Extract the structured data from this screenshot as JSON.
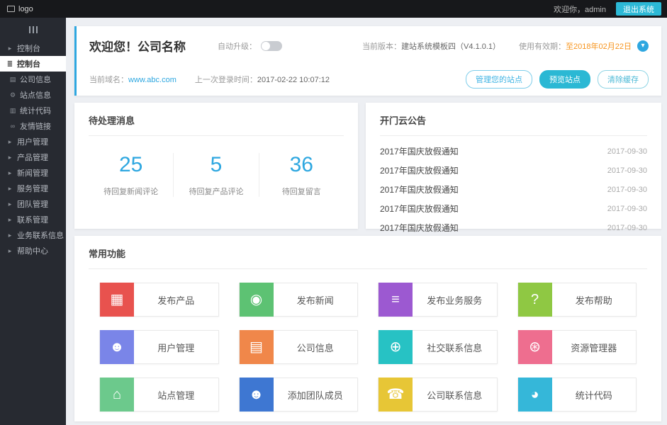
{
  "topbar": {
    "logo": "logo",
    "welcome": "欢迎你，admin",
    "logout": "退出系统"
  },
  "sidebar": {
    "items": [
      {
        "label": "控制台"
      },
      {
        "label": "控制台"
      },
      {
        "label": "公司信息"
      },
      {
        "label": "站点信息"
      },
      {
        "label": "统计代码"
      },
      {
        "label": "友情链接"
      },
      {
        "label": "用户管理"
      },
      {
        "label": "产品管理"
      },
      {
        "label": "新闻管理"
      },
      {
        "label": "服务管理"
      },
      {
        "label": "团队管理"
      },
      {
        "label": "联系管理"
      },
      {
        "label": "业务联系信息"
      },
      {
        "label": "帮助中心"
      }
    ]
  },
  "welcome": {
    "title": "欢迎您！公司名称",
    "auto_upgrade_label": "自动升级：",
    "version_label": "当前版本：",
    "version_value": "建站系统模板四（V4.1.0.1）",
    "validity_label": "使用有效期：",
    "validity_value": "至2018年02月22日",
    "domain_label": "当前域名：",
    "domain_value": "www.abc.com",
    "last_login_label": "上一次登录时间：",
    "last_login_value": "2017-02-22 10:07:12",
    "manage_site_button": "管理您的站点",
    "preview_site_button": "预览站点",
    "clear_cache_button": "清除缓存"
  },
  "pending": {
    "title": "待处理消息",
    "stats": [
      {
        "value": "25",
        "label": "待回复新闻评论"
      },
      {
        "value": "5",
        "label": "待回复产品评论"
      },
      {
        "value": "36",
        "label": "待回复留言"
      }
    ]
  },
  "announcements": {
    "title": "开门云公告",
    "items": [
      {
        "text": "2017年国庆放假通知",
        "date": "2017-09-30"
      },
      {
        "text": "2017年国庆放假通知",
        "date": "2017-09-30"
      },
      {
        "text": "2017年国庆放假通知",
        "date": "2017-09-30"
      },
      {
        "text": "2017年国庆放假通知",
        "date": "2017-09-30"
      },
      {
        "text": "2017年国庆放假通知",
        "date": "2017-09-30"
      }
    ]
  },
  "functions": {
    "title": "常用功能",
    "tiles": [
      {
        "label": "发布产品",
        "color": "#e8524e",
        "icon": "grid-icon"
      },
      {
        "label": "发布新闻",
        "color": "#5dc273",
        "icon": "news-globe-icon"
      },
      {
        "label": "发布业务服务",
        "color": "#9c59d1",
        "icon": "layers-icon"
      },
      {
        "label": "发布帮助",
        "color": "#8fc843",
        "icon": "question-icon"
      },
      {
        "label": "用户管理",
        "color": "#7a85e8",
        "icon": "user-gear-icon"
      },
      {
        "label": "公司信息",
        "color": "#f0874a",
        "icon": "building-icon"
      },
      {
        "label": "社交联系信息",
        "color": "#27c2c4",
        "icon": "globe-icon"
      },
      {
        "label": "资源管理器",
        "color": "#ee6e8f",
        "icon": "globe-gear-icon"
      },
      {
        "label": "站点管理",
        "color": "#6cc98c",
        "icon": "site-manage-icon"
      },
      {
        "label": "添加团队成员",
        "color": "#3e77d2",
        "icon": "user-plus-icon"
      },
      {
        "label": "公司联系信息",
        "color": "#e7c636",
        "icon": "phone-icon"
      },
      {
        "label": "统计代码",
        "color": "#35b7d9",
        "icon": "pie-chart-icon"
      }
    ]
  },
  "icons": {
    "chevron": "▸",
    "console": "≣",
    "building": "▤",
    "gear": "⚙",
    "stats": "▥",
    "link": "∞",
    "arrow_down": "▾",
    "grid": "▦",
    "news": "◉",
    "layers": "≡",
    "question": "?",
    "user": "☻",
    "globe": "⊕",
    "resource": "⊛",
    "site": "⌂",
    "user_plus": "☻",
    "phone": "☎",
    "pie": "◕"
  },
  "colors": {
    "accent_blue": "#2ea7e0",
    "teal": "#2cb9d6"
  }
}
